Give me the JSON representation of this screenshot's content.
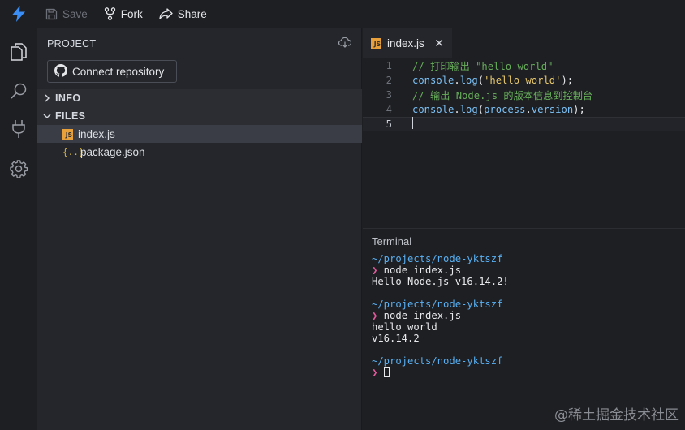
{
  "toolbar": {
    "save_label": "Save",
    "fork_label": "Fork",
    "share_label": "Share",
    "colors": {
      "logo": "#3b8ef5",
      "disabled": "#6d7079"
    }
  },
  "activitybar": {
    "items": [
      {
        "icon": "files-icon"
      },
      {
        "icon": "search-icon"
      },
      {
        "icon": "plug-icon"
      },
      {
        "icon": "gear-icon"
      }
    ]
  },
  "sidebar": {
    "title": "PROJECT",
    "connect_label": "Connect repository",
    "sections": {
      "info": "INFO",
      "files": "FILES"
    },
    "files": [
      {
        "name": "index.js",
        "icon": "js-file-icon",
        "active": true
      },
      {
        "name": "package.json",
        "icon": "json-file-icon",
        "active": false
      }
    ]
  },
  "editor": {
    "tab": {
      "label": "index.js",
      "close": "✕",
      "icon_text": "JS"
    },
    "lines": [
      {
        "num": "1",
        "text": "// 打印输出 \"hello world\""
      },
      {
        "num": "2",
        "parts": [
          "console",
          ".",
          "log",
          "(",
          "'hello world'",
          ");"
        ]
      },
      {
        "num": "3",
        "text": "// 输出 Node.js 的版本信息到控制台"
      },
      {
        "num": "4",
        "parts": [
          "console",
          ".",
          "log",
          "(",
          "process",
          ".",
          "version",
          ");"
        ]
      },
      {
        "num": "5",
        "text": ""
      }
    ]
  },
  "terminal": {
    "title": "Terminal",
    "blocks": [
      {
        "path": "~/projects/node-yktszf",
        "prompt": "❯",
        "cmd": " node index.js",
        "output": [
          "Hello Node.js v16.14.2!"
        ]
      },
      {
        "path": "~/projects/node-yktszf",
        "prompt": "❯",
        "cmd": " node index.js",
        "output": [
          "hello world",
          "v16.14.2"
        ]
      },
      {
        "path": "~/projects/node-yktszf",
        "prompt": "❯",
        "cmd": "",
        "output": []
      }
    ]
  },
  "watermark": "@稀土掘金技术社区"
}
